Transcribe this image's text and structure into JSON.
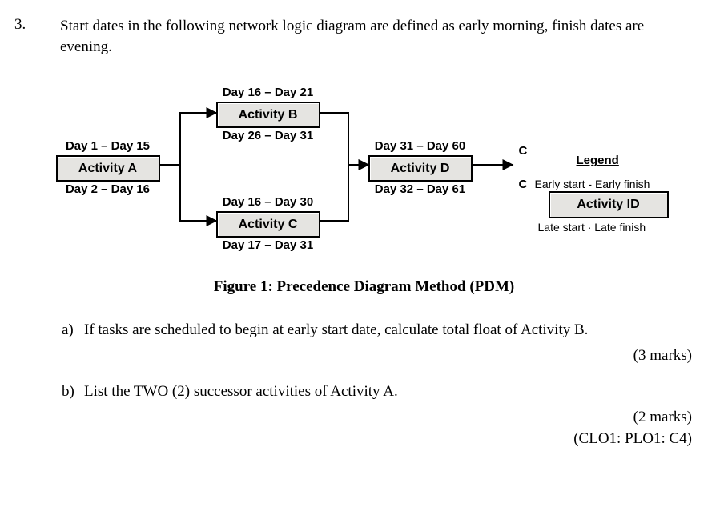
{
  "question": {
    "number": "3.",
    "prompt": "Start dates in the following network logic diagram are defined as early morning, finish dates are evening."
  },
  "nodes": {
    "A": {
      "es": "Day 1 – Day 15",
      "name": "Activity A",
      "ls": "Day 2 – Day 16"
    },
    "B": {
      "es": "Day 16 – Day 21",
      "name": "Activity B",
      "ls": "Day 26 – Day 31"
    },
    "C": {
      "es": "Day 16 – Day 30",
      "name": "Activity C",
      "ls": "Day 17 – Day 31"
    },
    "D": {
      "es": "Day 31 – Day 60",
      "name": "Activity D",
      "ls": "Day 32 – Day 61"
    },
    "legend": {
      "es": "Early start - Early finish",
      "name": "Activity ID",
      "ls": "Late start  ·  Late finish"
    }
  },
  "crit_top": "C",
  "crit_bottom": "C",
  "legend_title": "Legend",
  "figure_caption": "Figure 1:  Precedence Diagram Method (PDM)",
  "parts": {
    "a": {
      "label": "a)",
      "text": "If tasks are scheduled to begin at early start date, calculate total float of Activity B.",
      "marks": "(3 marks)"
    },
    "b": {
      "label": "b)",
      "text": "List the TWO (2) successor activities of Activity A.",
      "marks": "(2 marks)",
      "clo": "(CLO1: PLO1: C4)"
    }
  }
}
